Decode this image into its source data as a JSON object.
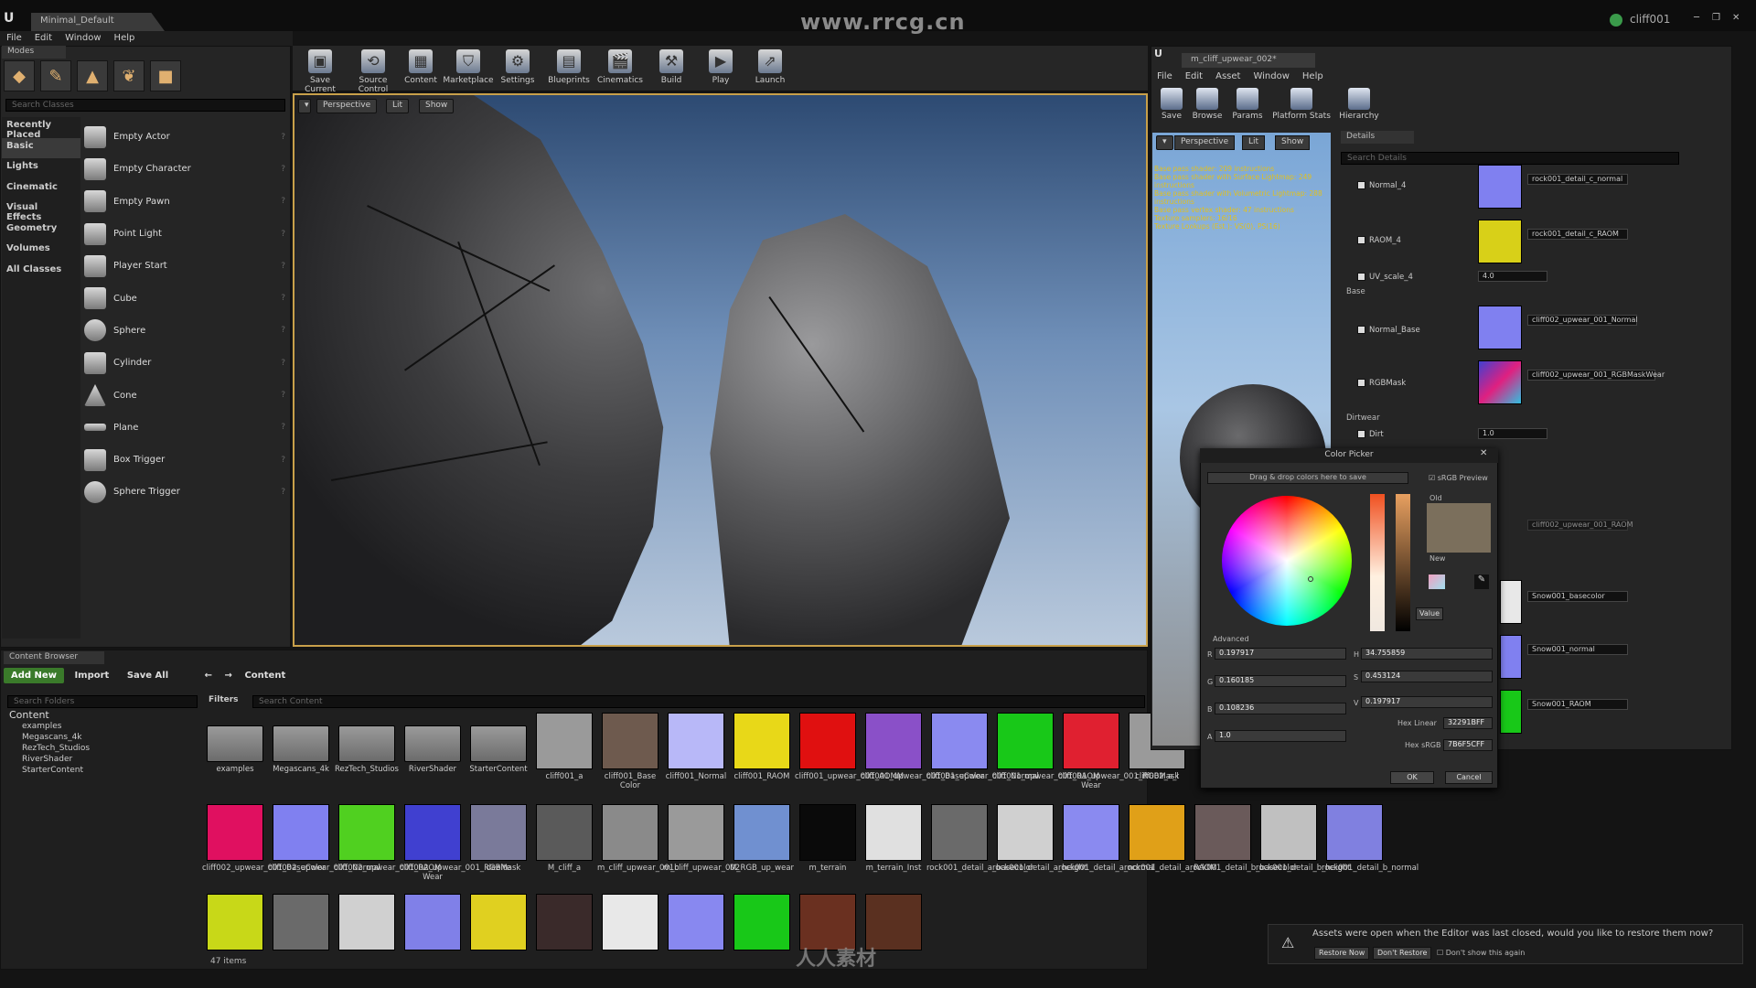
{
  "app": {
    "tab_title": "Minimal_Default",
    "watermark": "www.rrcg.cn",
    "user": "cliff001",
    "bottom_watermark": "人人素材"
  },
  "menu": [
    "File",
    "Edit",
    "Window",
    "Help"
  ],
  "modes": {
    "tab": "Modes",
    "search_placeholder": "Search Classes",
    "categories": [
      "Recently Placed",
      "Basic",
      "Lights",
      "Cinematic",
      "Visual Effects",
      "Geometry",
      "Volumes",
      "All Classes"
    ],
    "items": [
      "Empty Actor",
      "Empty Character",
      "Empty Pawn",
      "Point Light",
      "Player Start",
      "Cube",
      "Sphere",
      "Cylinder",
      "Cone",
      "Plane",
      "Box Trigger",
      "Sphere Trigger"
    ]
  },
  "toolbar": [
    "Save Current",
    "Source Control",
    "Content",
    "Marketplace",
    "Settings",
    "Blueprints",
    "Cinematics",
    "Build",
    "Play",
    "Launch"
  ],
  "viewport": {
    "perspective": "Perspective",
    "lit": "Lit",
    "show": "Show"
  },
  "content_browser": {
    "tab": "Content Browser",
    "add_new": "Add New",
    "import": "Import",
    "save_all": "Save All",
    "path": "Content",
    "search_folders": "Search Folders",
    "filters": "Filters",
    "search_content": "Search Content",
    "tree": {
      "root": "Content",
      "children": [
        "examples",
        "Megascans_4k",
        "RezTech_Studios",
        "RiverShader",
        "StarterContent"
      ]
    },
    "row1": [
      {
        "name": "examples",
        "color": "#8a8a8a",
        "folder": true
      },
      {
        "name": "Megascans_4k",
        "color": "#8a8a8a",
        "folder": true
      },
      {
        "name": "RezTech_Studios",
        "color": "#8a8a8a",
        "folder": true
      },
      {
        "name": "RiverShader",
        "color": "#8a8a8a",
        "folder": true
      },
      {
        "name": "StarterContent",
        "color": "#8a8a8a",
        "folder": true
      },
      {
        "name": "cliff001_a",
        "color": "#9a9a9a"
      },
      {
        "name": "cliff001_Base Color",
        "color": "#6e5a4e"
      },
      {
        "name": "cliff001_Normal",
        "color": "#b8b8f8"
      },
      {
        "name": "cliff001_RAOM",
        "color": "#e8d818"
      },
      {
        "name": "cliff001_upwear_001_AOMM",
        "color": "#e01010"
      },
      {
        "name": "cliff001_upwear_001_BaseColor",
        "color": "#8a50c8"
      },
      {
        "name": "cliff001_upwear_001_Normal",
        "color": "#8a8af0"
      },
      {
        "name": "cliff001_upwear_001_RAOM",
        "color": "#18c818"
      },
      {
        "name": "cliff001_upwear_001_RGBMask Wear",
        "color": "#e02030"
      },
      {
        "name": "cliff002_a_l",
        "color": "#9a9a9a"
      }
    ],
    "row2": [
      {
        "name": "cliff002_upwear_001_BaseColor",
        "color": "#e01060"
      },
      {
        "name": "cliff002_upwear_001_Normal",
        "color": "#8080f0"
      },
      {
        "name": "cliff002_upwear_001_RAOM",
        "color": "#50d020"
      },
      {
        "name": "cliff002_upwear_001_RGBMask Wear",
        "color": "#4040d0"
      },
      {
        "name": "deelte",
        "color": "#7a7a9a"
      },
      {
        "name": "M_cliff_a",
        "color": "#5a5a5a"
      },
      {
        "name": "m_cliff_upwear_001b",
        "color": "#8a8a8a"
      },
      {
        "name": "m_cliff_upwear_002",
        "color": "#9a9a9a"
      },
      {
        "name": "M_RGB_up_wear",
        "color": "#7090d0"
      },
      {
        "name": "m_terrain",
        "color": "#0a0a0a"
      },
      {
        "name": "m_terrain_Inst",
        "color": "#e0e0e0"
      },
      {
        "name": "rock001_detail_a_basecolor",
        "color": "#6a6a6a"
      },
      {
        "name": "rock001_detail_a_height",
        "color": "#d0d0d0"
      },
      {
        "name": "rock001_detail_a_normal",
        "color": "#8a8af0"
      },
      {
        "name": "rock001_detail_a_RAOM",
        "color": "#e0a018"
      },
      {
        "name": "rock001_detail_b_basecolor",
        "color": "#6a5a5a"
      },
      {
        "name": "rock001_detail_b_height",
        "color": "#c0c0c0"
      },
      {
        "name": "rock001_detail_b_normal",
        "color": "#8080e0"
      }
    ],
    "row3": [
      "#c8d818",
      "#6a6a6a",
      "#d0d0d0",
      "#8080e8",
      "#e0d020",
      "#3a2a2a",
      "#e8e8e8",
      "#8888f0",
      "#18c818",
      "#6a3020",
      "#5a3020"
    ],
    "items_count": "47 items"
  },
  "material_editor": {
    "tab": "m_cliff_upwear_002*",
    "menu": [
      "File",
      "Edit",
      "Asset",
      "Window",
      "Help"
    ],
    "toolbar": [
      "Save",
      "Browse",
      "Params",
      "Platform Stats",
      "Hierarchy"
    ],
    "preview": {
      "perspective": "Perspective",
      "lit": "Lit",
      "show": "Show"
    },
    "stats": [
      "Base pass shader: 209 instructions",
      "Base pass shader with Surface Lightmap: 249 instructions",
      "Base pass shader with Volumetric Lightmap: 288 instructions",
      "Base pass vertex shader: 47 instructions",
      "Texture samplers: 16/16",
      "Texture Lookups (Est.): VS(0), PS(16)"
    ],
    "details_tab": "Details",
    "search_details": "Search Details",
    "params": [
      {
        "label": "Normal_4",
        "value": "rock001_detail_c_normal",
        "color": "#8080f0"
      },
      {
        "label": "RAOM_4",
        "value": "rock001_detail_c_RAOM",
        "color": "#d8d018"
      },
      {
        "label": "UV_scale_4",
        "value": "4.0"
      },
      {
        "label": "Normal_Base",
        "value": "cliff002_upwear_001_Normal",
        "color": "#8080f0"
      },
      {
        "label": "RGBMask",
        "value": "cliff002_upwear_001_RGBMaskWear",
        "color": "#4040d0"
      },
      {
        "label": "Dirt",
        "value": "1.0"
      }
    ],
    "sections": [
      "Base",
      "Dirtwear"
    ],
    "right_values": [
      "cliff002_upwear_001_RAOM",
      "Snow001_basecolor",
      "Snow001_normal",
      "Snow001_RAOM"
    ]
  },
  "color_picker": {
    "title": "Color Picker",
    "drop_hint": "Drag & drop colors here to save",
    "srgb": "sRGB Preview",
    "old": "Old",
    "new": "New",
    "value_label": "Value",
    "advanced": "Advanced",
    "r_label": "R",
    "g_label": "G",
    "b_label": "B",
    "a_label": "A",
    "h_label": "H",
    "s_label": "S",
    "v_label": "V",
    "r": "0.197917",
    "g": "0.160185",
    "b": "0.108236",
    "a": "1.0",
    "h": "34.755859",
    "s": "0.453124",
    "v": "0.197917",
    "hex_linear_label": "Hex Linear",
    "hex_linear": "32291BFF",
    "hex_srgb_label": "Hex sRGB",
    "hex_srgb": "7B6F5CFF",
    "ok": "OK",
    "cancel": "Cancel",
    "old_color": "#7b6f5c"
  },
  "notification": {
    "message": "Assets were open when the Editor was last closed, would you like to restore them now?",
    "restore": "Restore Now",
    "dont_restore": "Don't Restore",
    "dont_show": "Don't show this again"
  }
}
